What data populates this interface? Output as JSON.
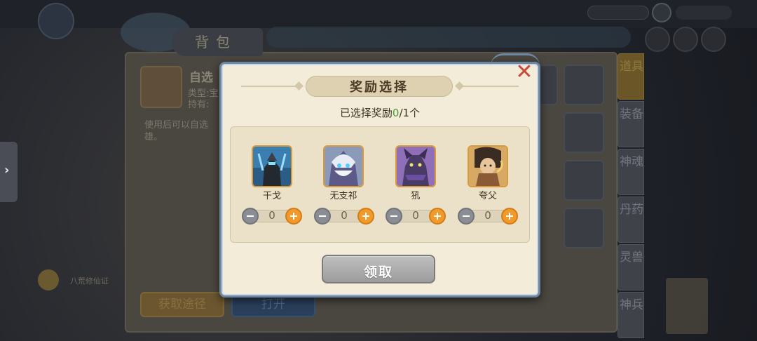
{
  "background": {
    "bag_title": "背包",
    "item": {
      "name": "自选",
      "type_label": "类型:宝",
      "owner_label": "持有:",
      "description": "使用后可以自选 雄。"
    },
    "buttons": {
      "get_path": "获取途径",
      "open": "打开"
    },
    "side_tabs": [
      {
        "label": "道具",
        "active": true
      },
      {
        "label": "装备",
        "active": false
      },
      {
        "label": "神魂",
        "active": false
      },
      {
        "label": "丹药",
        "active": false
      },
      {
        "label": "灵兽",
        "active": false
      },
      {
        "label": "神兵",
        "active": false
      }
    ],
    "bottom_left_text": "八荒修仙证"
  },
  "modal": {
    "title": "奖励选择",
    "selected_prefix": "已选择奖励",
    "selected_count": "0",
    "selected_suffix": "/1个",
    "rewards": [
      {
        "name": "干戈",
        "quantity": "0",
        "icon": "hero-portrait-icon"
      },
      {
        "name": "无支祁",
        "quantity": "0",
        "icon": "hero-portrait-icon"
      },
      {
        "name": "犼",
        "quantity": "0",
        "icon": "hero-portrait-icon"
      },
      {
        "name": "夸父",
        "quantity": "0",
        "icon": "hero-portrait-icon"
      }
    ],
    "claim_label": "领取",
    "close_glyph": "✕"
  },
  "colors": {
    "modal_bg": "#f3ecd9",
    "modal_border": "#6d87a3",
    "close": "#c94837",
    "plus": "#f19a2b",
    "minus": "#8a8e94",
    "selected_count": "#4a9a35",
    "claim_disabled": "#a9a9a9"
  }
}
